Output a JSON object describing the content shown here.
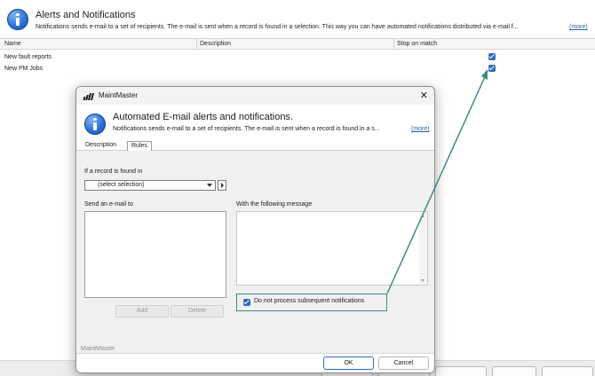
{
  "background": {
    "title": "Alerts and Notifications",
    "subtitle": "Notifications sends e-mail to a set of recipients. The e-mail is sent when a record is found in a selection. This way you can have automated notifications distributed via e-mail f...",
    "more_link": "(more)",
    "columns": [
      "Name",
      "Description",
      "Stop on match"
    ],
    "rows": [
      {
        "name": "New fault reports",
        "stop_on_match": true
      },
      {
        "name": "New PM Jobs",
        "stop_on_match": true
      }
    ]
  },
  "dialog": {
    "app_title": "MaintMaster",
    "close_glyph": "✕",
    "title": "Automated E-mail alerts and notifications.",
    "subtitle": "Notifications sends e-mail to a set of recipients. The e-mail is sent when a record is found in a s...",
    "more_link": "(more)",
    "tabs": [
      "Description",
      "Rules"
    ],
    "active_tab": "Rules",
    "if_found_label": "If a record is found in",
    "selection_value": "(select selection)",
    "send_to_label": "Send an e-mail to",
    "message_label": "With the following message",
    "add_label": "Add",
    "delete_label": "Delete",
    "do_not_process_label": "Do not process subsequent notifications",
    "do_not_process_checked": true,
    "footer_brand": "MaintMaster",
    "ok_label": "OK",
    "cancel_label": "Cancel"
  },
  "colors": {
    "checkbox": "#2f6db5",
    "annotation": "#3f8a86",
    "ok_border": "#2a6ec2"
  }
}
